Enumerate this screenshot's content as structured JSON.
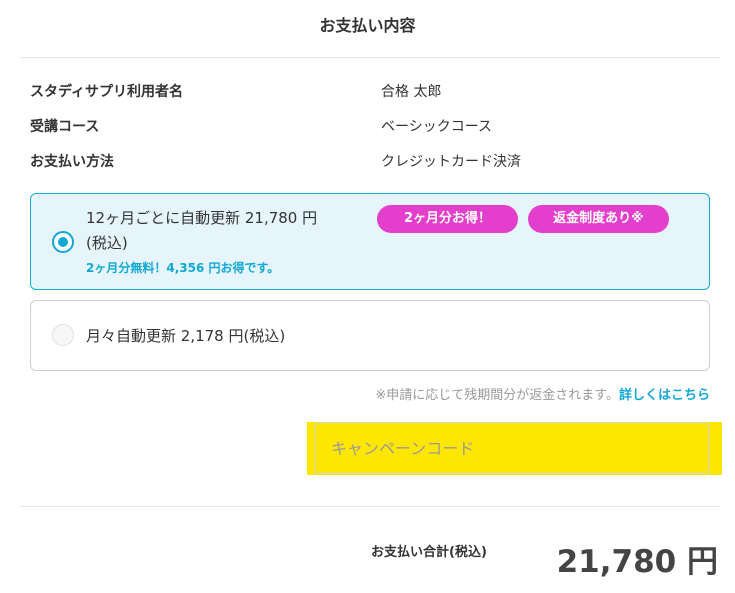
{
  "header": {
    "title": "お支払い内容"
  },
  "info": [
    {
      "label": "スタディサプリ利用者名",
      "value": "合格 太郎"
    },
    {
      "label": "受講コース",
      "value": "ベーシックコース"
    },
    {
      "label": "お支払い方法",
      "value": "クレジットカード決済"
    }
  ],
  "plans": [
    {
      "title_line1": "12ヶ月ごとに自動更新 21,780 円",
      "title_line2": "(税込)",
      "note": "2ヶ月分無料！4,356 円お得です。",
      "badges": [
        "2ヶ月分お得！",
        "返金制度あり※"
      ],
      "selected": true
    },
    {
      "title": "月々自動更新 2,178 円(税込)",
      "selected": false
    }
  ],
  "refund": {
    "note": "※申請に応じて残期間分が返金されます。",
    "link": "詳しくはこちら"
  },
  "campaign": {
    "placeholder": "キャンペーンコード",
    "value": "",
    "highlight_color": "#fde700"
  },
  "total": {
    "label": "お支払い合計(税込)",
    "amount": "21,780 円"
  },
  "colors": {
    "accent": "#12a8d6",
    "badge": "#e43fcc",
    "selected_bg": "#e5f5fb"
  }
}
